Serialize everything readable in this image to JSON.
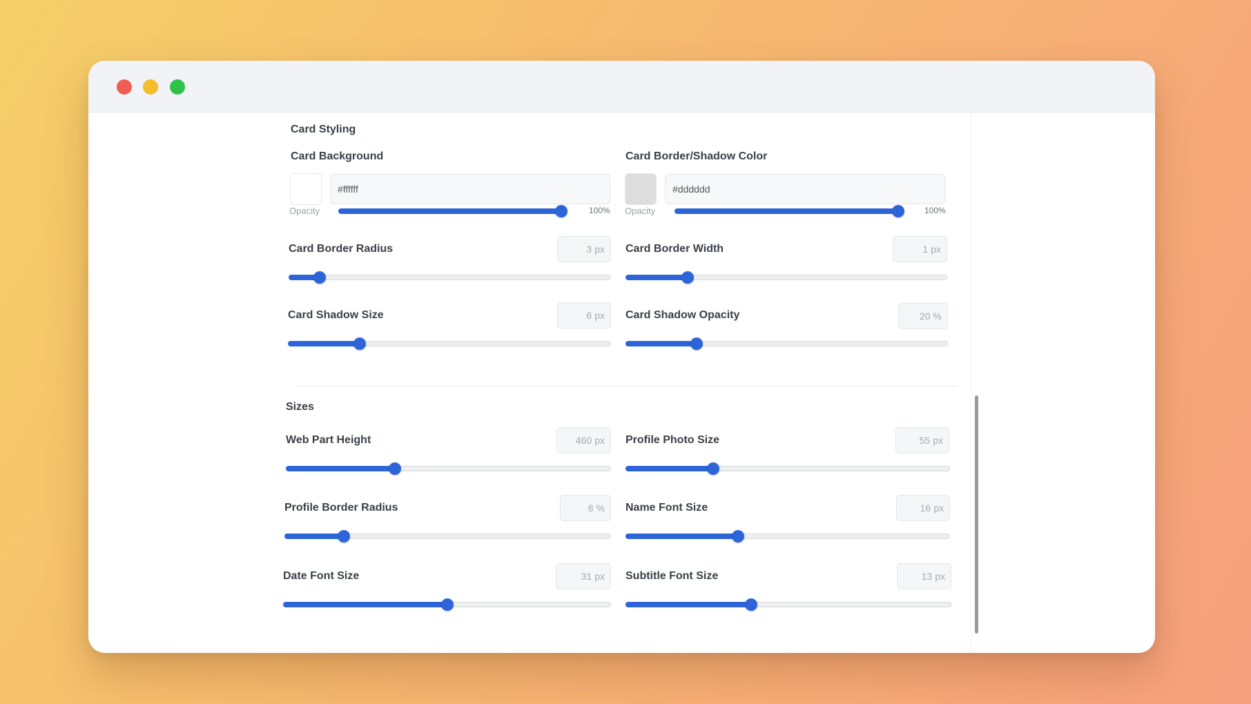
{
  "colors": {
    "accent": "#2d64d8",
    "close": "#f05d56",
    "minimize": "#f7bc2c",
    "maximize": "#2fc24a"
  },
  "card_styling": {
    "title": "Card Styling",
    "background": {
      "label": "Card Background",
      "value": "#ffffff",
      "swatch": "#ffffff",
      "opacity_label": "Opacity",
      "opacity": 100,
      "opacity_text": "100%"
    },
    "border_color": {
      "label": "Card Border/Shadow Color",
      "value": "#dddddd",
      "swatch": "#dddddd",
      "opacity_label": "Opacity",
      "opacity": 100,
      "opacity_text": "100%"
    },
    "sliders": [
      {
        "label": "Card Border Radius",
        "value": "3",
        "unit": "px",
        "fraction": 0.08
      },
      {
        "label": "Card Border Width",
        "value": "1",
        "unit": "px",
        "fraction": 0.18
      },
      {
        "label": "Card Shadow Size",
        "value": "6",
        "unit": "px",
        "fraction": 0.21
      },
      {
        "label": "Card Shadow Opacity",
        "value": "20",
        "unit": "%",
        "fraction": 0.21
      }
    ]
  },
  "sizes": {
    "title": "Sizes",
    "sliders": [
      {
        "label": "Web Part Height",
        "value": "460",
        "unit": "px",
        "fraction": 0.33
      },
      {
        "label": "Profile Photo Size",
        "value": "55",
        "unit": "px",
        "fraction": 0.26
      },
      {
        "label": "Profile Border Radius",
        "value": "8",
        "unit": "%",
        "fraction": 0.17
      },
      {
        "label": "Name Font Size",
        "value": "16",
        "unit": "px",
        "fraction": 0.34
      },
      {
        "label": "Date Font Size",
        "value": "31",
        "unit": "px",
        "fraction": 0.5
      },
      {
        "label": "Subtitle Font Size",
        "value": "13",
        "unit": "px",
        "fraction": 0.38
      }
    ]
  }
}
